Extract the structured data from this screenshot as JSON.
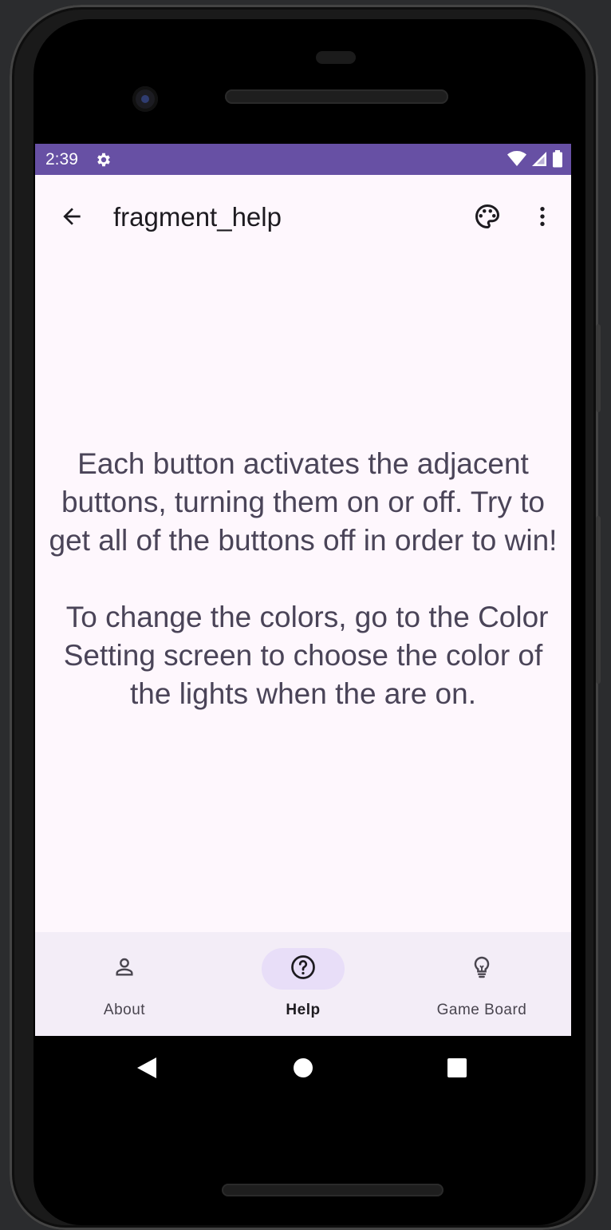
{
  "status_bar": {
    "time": "2:39",
    "icons": [
      "settings-gear-icon",
      "wifi-icon",
      "cell-signal-icon",
      "battery-icon"
    ],
    "color": "#6750a4"
  },
  "app_bar": {
    "title": "fragment_help",
    "actions": [
      "back-arrow-icon",
      "palette-icon",
      "more-vert-icon"
    ]
  },
  "main": {
    "help_text": "Each button activates the adjacent buttons, turning them on or off. Try to get all of the buttons off in order to win!\n\n To change the colors, go to the Color Setting screen to choose the color of the lights when the are on."
  },
  "bottom_nav": {
    "items": [
      {
        "label": "About",
        "icon": "person-icon",
        "active": false
      },
      {
        "label": "Help",
        "icon": "help-circle-icon",
        "active": true
      },
      {
        "label": "Game Board",
        "icon": "lightbulb-icon",
        "active": false
      }
    ]
  },
  "system_nav": [
    "back-triangle-icon",
    "home-circle-icon",
    "recents-square-icon"
  ]
}
